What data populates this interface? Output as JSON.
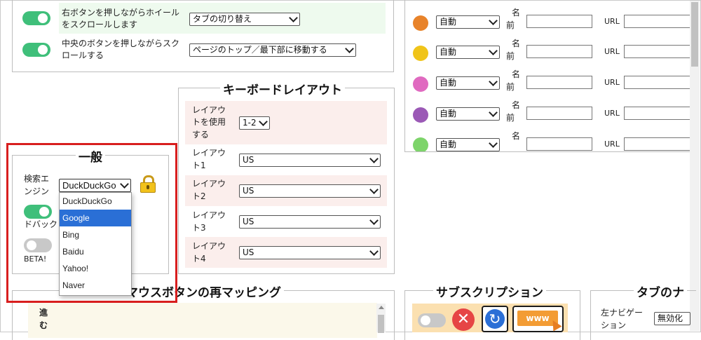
{
  "mouse_panel": {
    "row1_label": "右ボタンを押しながらホイールをスクロールします",
    "row1_label_a": "右ボタンを押しながらホイール",
    "row1_label_b": "をスクロールします",
    "row1_value": "タブの切り替え",
    "row2_label_a": "中央のボタンを押しながらスク",
    "row2_label_b": "ロールする",
    "row2_value": "ページのトップ／最下部に移動する"
  },
  "colors_panel": {
    "rows": [
      {
        "color": "#e8832a",
        "mode": "自動",
        "name_label_a": "名",
        "name_label_b": "前",
        "url_label": "URL"
      },
      {
        "color": "#f0c419",
        "mode": "自動",
        "name_label_a": "名",
        "name_label_b": "前",
        "url_label": "URL"
      },
      {
        "color": "#e06ac0",
        "mode": "自動",
        "name_label_a": "名",
        "name_label_b": "前",
        "url_label": "URL"
      },
      {
        "color": "#9b59b6",
        "mode": "自動",
        "name_label_a": "名",
        "name_label_b": "前",
        "url_label": "URL"
      },
      {
        "color": "#7dd46a",
        "mode": "自動",
        "name_label_a": "名",
        "name_label_b": "",
        "url_label": "URL"
      }
    ]
  },
  "keyboard": {
    "title": "キーボードレイアウト",
    "use_label_a": "レイアウ",
    "use_label_b": "トを使用",
    "use_label_c": "する",
    "use_value": "1-2",
    "layouts": [
      {
        "label_a": "レイアウ",
        "label_b": "ト1",
        "value": "US"
      },
      {
        "label_a": "レイアウ",
        "label_b": "ト2",
        "value": "US"
      },
      {
        "label_a": "レイアウ",
        "label_b": "ト3",
        "value": "US"
      },
      {
        "label_a": "レイアウ",
        "label_b": "ト4",
        "value": "US"
      }
    ]
  },
  "general": {
    "title": "一般",
    "engine_label_a": "検索エ",
    "engine_label_b": "ンジン",
    "engine_value": "DuckDuckGo",
    "feedback_label": "ドバック",
    "beta_label": "BETA!",
    "dropdown_options": [
      "DuckDuckGo",
      "Google",
      "Bing",
      "Baidu",
      "Yahoo!",
      "Naver"
    ],
    "highlighted_option": "Google"
  },
  "remap": {
    "title": "マウスボタンの再マッピング",
    "first_label_a": "進",
    "first_label_b": "む"
  },
  "subscription": {
    "title": "サブスクリプション",
    "www_text": "www"
  },
  "tab_nav": {
    "title": "タブのナ",
    "left_nav_label_a": "左ナビゲー",
    "left_nav_label_b": "ション",
    "left_nav_value": "無効化"
  },
  "accent": {
    "toggle_on": "#3fbf7a",
    "highlight_red": "#d81e1e",
    "dropdown_highlight": "#2a6fd6"
  }
}
